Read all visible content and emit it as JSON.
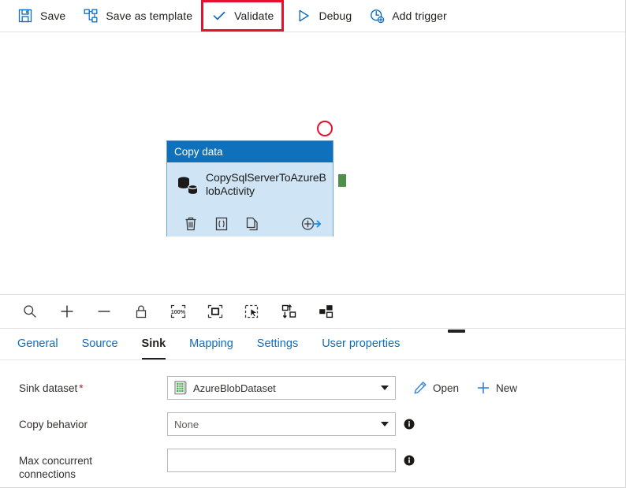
{
  "command_bar": {
    "items": [
      {
        "label": "Save",
        "icon": "save-icon"
      },
      {
        "label": "Save as template",
        "icon": "save-as-template-icon"
      },
      {
        "label": "Validate",
        "icon": "checkmark-icon"
      },
      {
        "label": "Debug",
        "icon": "play-triangle-icon"
      },
      {
        "label": "Add trigger",
        "icon": "add-trigger-icon"
      }
    ],
    "highlighted_item": "Validate",
    "highlight_color": "#e8112d"
  },
  "canvas": {
    "node": {
      "header_title": "Copy data",
      "activity_name": "CopySqlServerToAzureBlobActivity",
      "header_color": "#0f71bb",
      "body_color": "#cfe4f5",
      "border_color": "#6aa6cf",
      "actions": [
        {
          "name": "delete-icon",
          "title": "Delete"
        },
        {
          "name": "code-icon",
          "title": "Code"
        },
        {
          "name": "clone-icon",
          "title": "Clone"
        },
        {
          "name": "add-output-icon",
          "title": "Add output"
        }
      ],
      "success_connector_color": "#4e8f4a",
      "status_circle_color": "#e8112d"
    }
  },
  "canvas_tools": {
    "items": [
      {
        "name": "zoom-search-icon",
        "title": "Zoom"
      },
      {
        "name": "zoom-in-icon",
        "title": "Zoom in"
      },
      {
        "name": "zoom-out-icon",
        "title": "Zoom out"
      },
      {
        "name": "lock-icon",
        "title": "Lock canvas"
      },
      {
        "name": "zoom-100-percent-icon",
        "title": "100%"
      },
      {
        "name": "zoom-to-fit-icon",
        "title": "Zoom to fit"
      },
      {
        "name": "select-all-icon",
        "title": "Select all"
      },
      {
        "name": "auto-align-icon",
        "title": "Auto align"
      },
      {
        "name": "layout-icon",
        "title": "Layout"
      }
    ],
    "zoom_level_label": "100%"
  },
  "properties": {
    "tabs": [
      {
        "label": "General",
        "active": false
      },
      {
        "label": "Source",
        "active": false
      },
      {
        "label": "Sink",
        "active": true
      },
      {
        "label": "Mapping",
        "active": false
      },
      {
        "label": "Settings",
        "active": false
      },
      {
        "label": "User properties",
        "active": false
      }
    ],
    "fields": {
      "sink_dataset": {
        "label": "Sink dataset",
        "required_marker": "*",
        "value": "AzureBlobDataset",
        "icon": "dataset-csv-icon",
        "open_label": "Open",
        "new_label": "New"
      },
      "copy_behavior": {
        "label": "Copy behavior",
        "value": "None",
        "placeholder": "None"
      },
      "max_concurrent_connections": {
        "label_line1": "Max concurrent",
        "label_line2": "connections",
        "value": "",
        "placeholder": ""
      }
    }
  }
}
